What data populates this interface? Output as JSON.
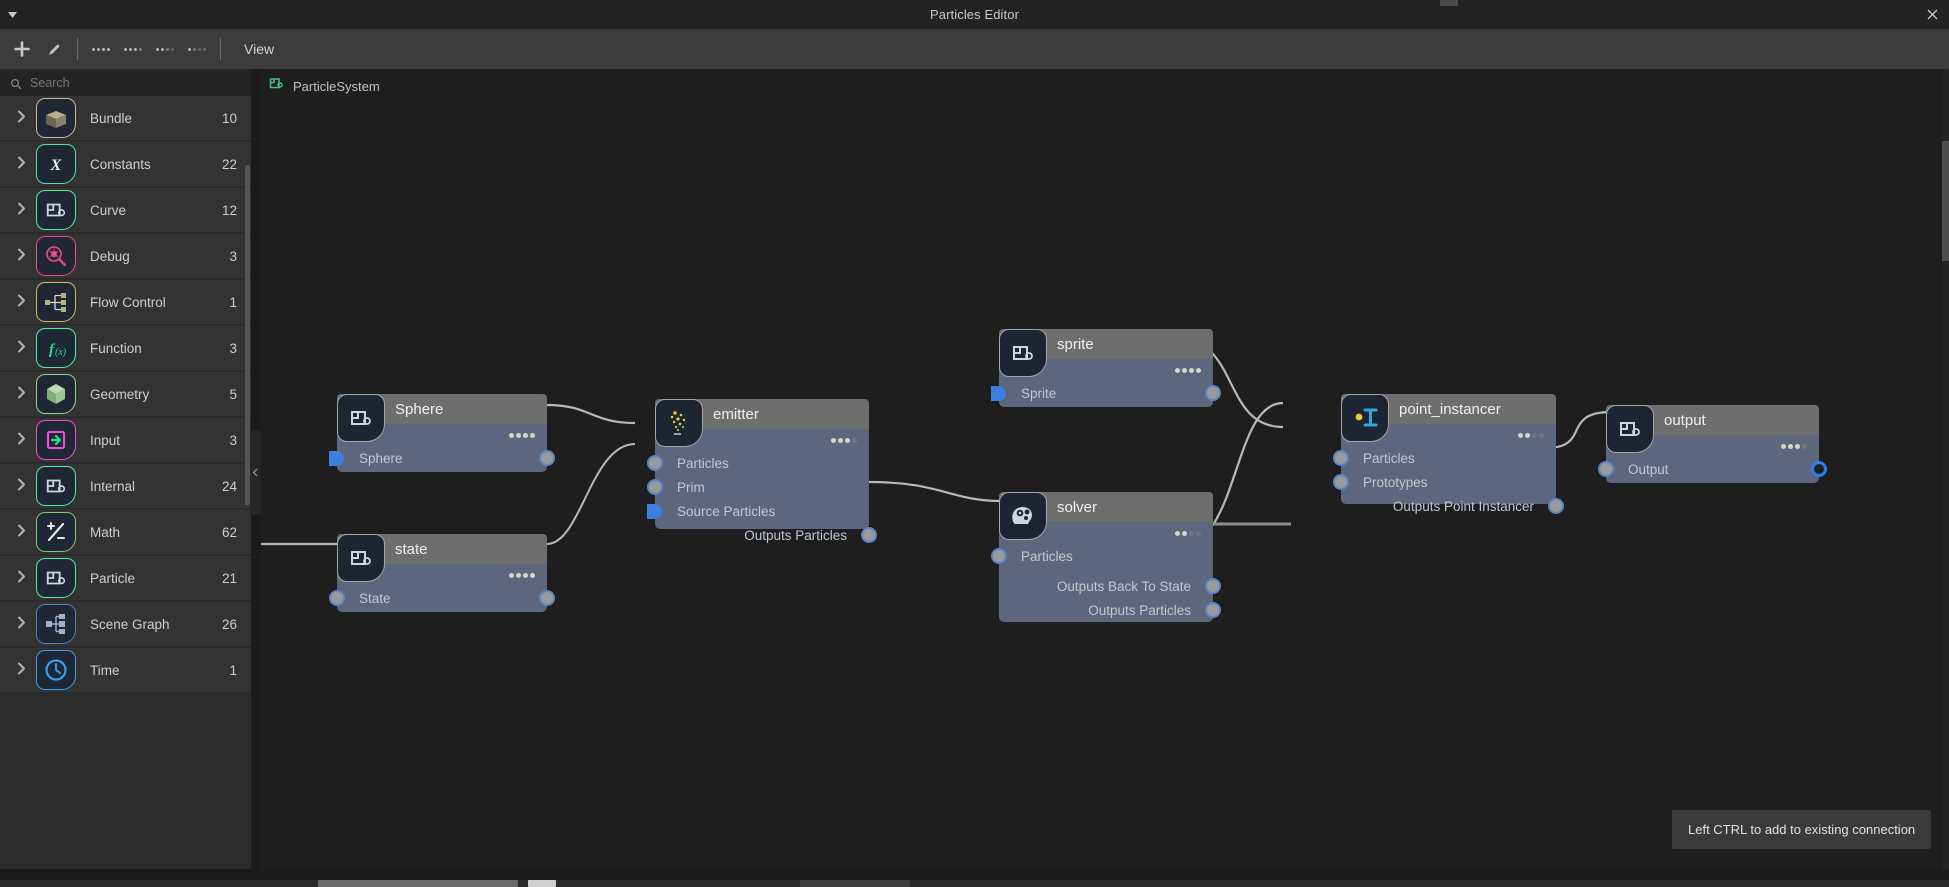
{
  "window": {
    "title": "Particles Editor",
    "menu_caret_icon": "caret-down-icon",
    "close_icon": "close-icon"
  },
  "toolbar": {
    "add_label": "+",
    "add_icon": "plus-icon",
    "edit_icon": "pencil-icon",
    "dots_icons": [
      "dots-four-icon",
      "dots-four-b-icon",
      "dots-four-c-icon",
      "dots-four-d-icon"
    ],
    "view_label": "View"
  },
  "search": {
    "placeholder": "Search",
    "icon": "search-icon",
    "value": ""
  },
  "sidebar": {
    "expand_icon": "chevron-right-icon",
    "collapse_handle_icon": "chevron-left-icon",
    "items": [
      {
        "label": "Bundle",
        "count": "10",
        "icon": "bundle-box-icon",
        "accent": "#cbbf9a"
      },
      {
        "label": "Constants",
        "count": "22",
        "icon": "constants-x-icon",
        "accent": "#5de0a0"
      },
      {
        "label": "Curve",
        "count": "12",
        "icon": "curve-node-icon",
        "accent": "#4ef0a5"
      },
      {
        "label": "Debug",
        "count": "3",
        "icon": "debug-bug-icon",
        "accent": "#ef4d7e"
      },
      {
        "label": "Flow Control",
        "count": "1",
        "icon": "flow-control-icon",
        "accent": "#c9c25a"
      },
      {
        "label": "Function",
        "count": "3",
        "icon": "function-fx-icon",
        "accent": "#4ef0a5"
      },
      {
        "label": "Geometry",
        "count": "5",
        "icon": "geometry-cube-icon",
        "accent": "#8fd98f"
      },
      {
        "label": "Input",
        "count": "3",
        "icon": "input-arrow-icon",
        "accent": "#f050d0"
      },
      {
        "label": "Internal",
        "count": "24",
        "icon": "internal-node-icon",
        "accent": "#4ef0a5"
      },
      {
        "label": "Math",
        "count": "62",
        "icon": "math-ops-icon",
        "accent": "#7ec96b"
      },
      {
        "label": "Particle",
        "count": "21",
        "icon": "particle-node-icon",
        "accent": "#4ef0a5"
      },
      {
        "label": "Scene Graph",
        "count": "26",
        "icon": "scene-graph-icon",
        "accent": "#5a7fb0"
      },
      {
        "label": "Time",
        "count": "1",
        "icon": "time-clock-icon",
        "accent": "#33a0ef"
      }
    ]
  },
  "canvas": {
    "breadcrumb": {
      "icon": "particle-system-icon",
      "label": "ParticleSystem"
    },
    "tooltip": "Left CTRL to add to existing connection",
    "nodes": [
      {
        "id": "sphere",
        "title": "Sphere",
        "icon": "curve-node-icon",
        "badge": [
          1,
          1,
          1,
          1
        ],
        "inputs": [
          {
            "label": "Sphere",
            "pin": "halfblue"
          }
        ],
        "outputs": [
          {
            "label": "",
            "pin": "filled-gray"
          }
        ]
      },
      {
        "id": "state",
        "title": "state",
        "icon": "curve-node-icon",
        "badge": [
          1,
          1,
          1,
          1
        ],
        "inputs": [
          {
            "label": "State",
            "pin": "filled-gray"
          }
        ],
        "outputs": [
          {
            "label": "",
            "pin": "filled-gray"
          }
        ]
      },
      {
        "id": "emitter",
        "title": "emitter",
        "icon": "emitter-sparkles-icon",
        "badge": [
          1,
          1,
          1,
          0
        ],
        "inputs": [
          {
            "label": "Particles",
            "pin": "filled-gray"
          },
          {
            "label": "Prim",
            "pin": "filled-gray"
          },
          {
            "label": "Source Particles",
            "pin": "halfblue"
          }
        ],
        "outputs": [
          {
            "label": "Outputs Particles",
            "pin": "filled-gray"
          }
        ]
      },
      {
        "id": "sprite",
        "title": "sprite",
        "icon": "curve-node-icon",
        "badge": [
          1,
          1,
          1,
          1
        ],
        "inputs": [
          {
            "label": "Sprite",
            "pin": "halfblue"
          }
        ],
        "outputs": [
          {
            "label": "",
            "pin": "filled-gray"
          }
        ]
      },
      {
        "id": "solver",
        "title": "solver",
        "icon": "solver-brain-icon",
        "badge": [
          1,
          1,
          0,
          0
        ],
        "inputs": [
          {
            "label": "Particles",
            "pin": "filled-gray"
          }
        ],
        "outputs": [
          {
            "label": "Outputs Back To State",
            "pin": "filled-gray"
          },
          {
            "label": "Outputs Particles",
            "pin": "filled-gray"
          }
        ]
      },
      {
        "id": "point_instancer",
        "title": "point_instancer",
        "icon": "point-instancer-icon",
        "badge": [
          1,
          1,
          0,
          0
        ],
        "inputs": [
          {
            "label": "Particles",
            "pin": "filled-gray"
          },
          {
            "label": "Prototypes",
            "pin": "filled-gray"
          }
        ],
        "outputs": [
          {
            "label": "Outputs Point Instancer",
            "pin": "filled-gray"
          }
        ]
      },
      {
        "id": "output",
        "title": "output",
        "icon": "curve-node-icon",
        "badge": [
          1,
          1,
          1,
          0
        ],
        "inputs": [
          {
            "label": "Output",
            "pin": "filled-gray"
          }
        ],
        "outputs": [
          {
            "label": "",
            "pin": "empty"
          }
        ]
      }
    ]
  },
  "colors": {
    "node_header": "#6e6e6e",
    "node_body": "#5c667c",
    "pin_ring": "#5a86c9",
    "pin_blue": "#3b7fe0",
    "wire": "#b9b9b9",
    "canvas_bg": "#1e1e1e",
    "sidebar_bg": "#2b2b2b",
    "toolbar_bg": "#3c3c3c",
    "titlebar_bg": "#232323"
  }
}
